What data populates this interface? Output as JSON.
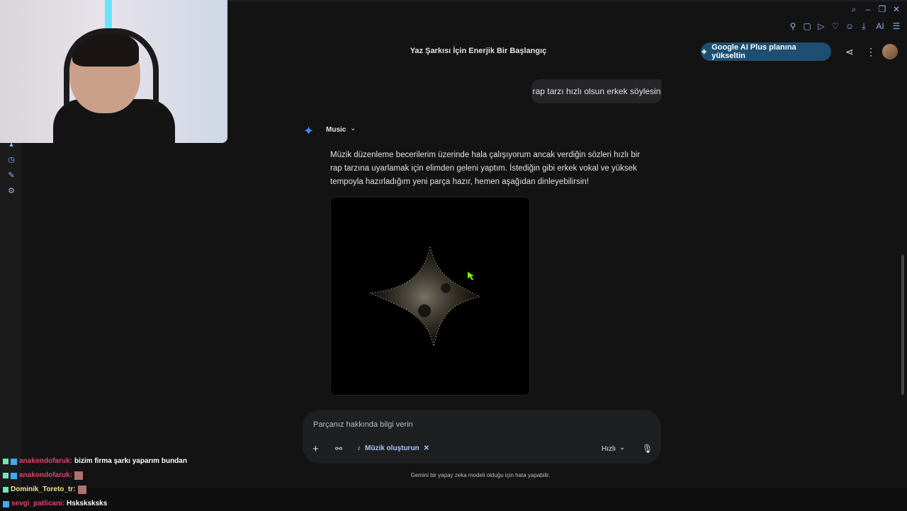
{
  "app": {
    "title": "Yaz Şarkısı İçin Enerjik Bir Başlangıç",
    "upgrade_label": "Google AI Plus planına yükseltin"
  },
  "toolbar": {
    "ai_label": "AI"
  },
  "conversation": {
    "user_message": "rap tarzı hızlı olsun erkek söylesin",
    "model_name": "Music",
    "reply": "Müzik düzenleme becerilerim üzerinde hala çalışıyorum ancak verdiğin sözleri hızlı bir rap tarzına uyarlamak için elimden geleni yaptım. İstediğin gibi erkek vokal ve yüksek tempoyla hazırladığım yeni parça hazır, hemen aşağıdan dinleyebilirsin!"
  },
  "composer": {
    "placeholder": "Parçanız hakkında bilgi verin",
    "chip_label": "Müzik oluşturun",
    "speed_label": "Hızlı"
  },
  "footer": {
    "disclaimer": "Gemini bir yapay zeka modeli olduğu için hata yapabilir."
  },
  "stream_chat": [
    {
      "user": "anakondofaruk:",
      "message": "bizim firma şarkı yaparım bundan",
      "color": "#e0446b"
    },
    {
      "user": "anakondofaruk:",
      "message": "",
      "color": "#e0446b"
    },
    {
      "user": "Dominik_Toreto_tr:",
      "message": "",
      "color": "#f0e68c"
    },
    {
      "user": "sevgi_patlicani:",
      "message": "Hsksksksks",
      "color": "#e0446b"
    }
  ],
  "colors": {
    "accent": "#4285f4",
    "upgrade_bg": "#1d4f72",
    "background": "#131314"
  }
}
